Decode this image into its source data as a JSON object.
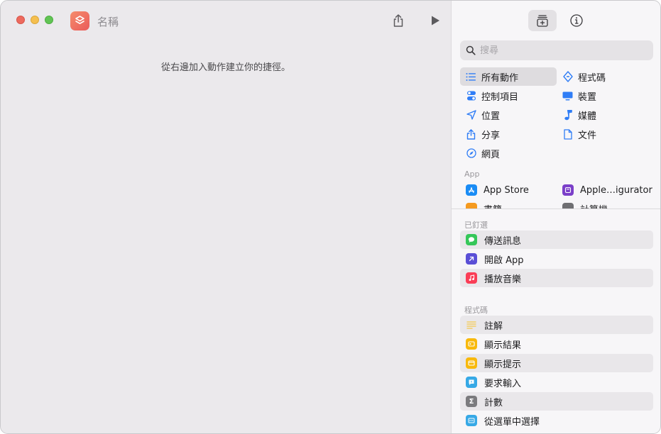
{
  "window": {
    "title": "名稱"
  },
  "canvas": {
    "empty_message": "從右邊加入動作建立你的捷徑。"
  },
  "sidebar": {
    "search_placeholder": "搜尋",
    "categories": [
      {
        "label": "所有動作",
        "icon": "list-icon",
        "selected": true
      },
      {
        "label": "程式碼",
        "icon": "code-icon"
      },
      {
        "label": "控制項目",
        "icon": "toggle-icon"
      },
      {
        "label": "裝置",
        "icon": "display-icon"
      },
      {
        "label": "位置",
        "icon": "location-arrow-icon"
      },
      {
        "label": "媒體",
        "icon": "music-note-icon"
      },
      {
        "label": "分享",
        "icon": "share-icon"
      },
      {
        "label": "文件",
        "icon": "document-icon"
      },
      {
        "label": "網頁",
        "icon": "compass-icon"
      }
    ],
    "apps_header": "App",
    "apps": [
      {
        "label": "App Store",
        "color": "#1a8cf5"
      },
      {
        "label": "Apple…igurator",
        "color": "#7b3fc9"
      },
      {
        "label": "書籍",
        "color": "#f59a1f"
      },
      {
        "label": "計算機",
        "color": "#6f6f72"
      }
    ],
    "pinned_header": "已釘選",
    "pinned": [
      {
        "label": "傳送訊息",
        "color": "#35c759"
      },
      {
        "label": "開啟 App",
        "color": "#5a4fd6"
      },
      {
        "label": "播放音樂",
        "color": "#fa3d56"
      }
    ],
    "code_header": "程式碼",
    "code_actions": [
      {
        "label": "註解",
        "color": "#f6d25a"
      },
      {
        "label": "顯示結果",
        "color": "#f8b90c"
      },
      {
        "label": "顯示提示",
        "color": "#f8b90c"
      },
      {
        "label": "要求輸入",
        "color": "#37a9e6"
      },
      {
        "label": "計數",
        "color": "#7b7b7e"
      },
      {
        "label": "從選單中選擇",
        "color": "#37a9e6"
      }
    ]
  }
}
